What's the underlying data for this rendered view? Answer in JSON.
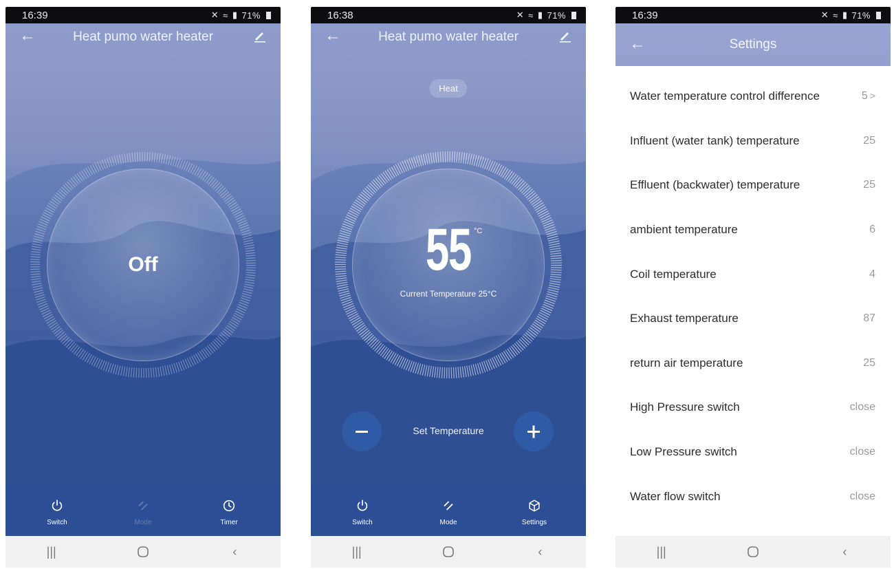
{
  "screens": [
    {
      "status": {
        "time": "16:39",
        "battery": "71%"
      },
      "header": {
        "title": "Heat pumo water heater"
      },
      "dial": {
        "state_label": "Off"
      },
      "tabs": [
        {
          "label": "Switch",
          "icon": "power-icon",
          "enabled": true
        },
        {
          "label": "Mode",
          "icon": "mode-icon",
          "enabled": false
        },
        {
          "label": "Timer",
          "icon": "clock-icon",
          "enabled": true
        }
      ]
    },
    {
      "status": {
        "time": "16:38",
        "battery": "71%"
      },
      "header": {
        "title": "Heat pumo water heater"
      },
      "mode_chip": "Heat",
      "dial": {
        "set_value": "55",
        "unit": "°C",
        "current_label": "Current Temperature 25°C"
      },
      "set_temperature_label": "Set Temperature",
      "tabs": [
        {
          "label": "Switch",
          "icon": "power-icon",
          "enabled": true
        },
        {
          "label": "Mode",
          "icon": "mode-icon",
          "enabled": true
        },
        {
          "label": "Settings",
          "icon": "cube-icon",
          "enabled": true
        }
      ]
    },
    {
      "status": {
        "time": "16:39",
        "battery": "71%"
      },
      "header": {
        "title": "Settings"
      },
      "rows": [
        {
          "label": "Water temperature control difference",
          "value": "5",
          "has_chevron": true
        },
        {
          "label": "Influent (water tank) temperature",
          "value": "25"
        },
        {
          "label": "Effluent (backwater) temperature",
          "value": "25"
        },
        {
          "label": "ambient temperature",
          "value": "6"
        },
        {
          "label": "Coil temperature",
          "value": "4"
        },
        {
          "label": "Exhaust temperature",
          "value": "87"
        },
        {
          "label": "return air temperature",
          "value": "25"
        },
        {
          "label": "High Pressure switch",
          "value": "close"
        },
        {
          "label": "Low Pressure switch",
          "value": "close"
        },
        {
          "label": "Water flow switch",
          "value": "close"
        }
      ]
    }
  ],
  "colors": {
    "accent_blue": "#2f5aa6",
    "tab_bar": "#2c4e97",
    "header_lavender": "#9aa4d2"
  }
}
